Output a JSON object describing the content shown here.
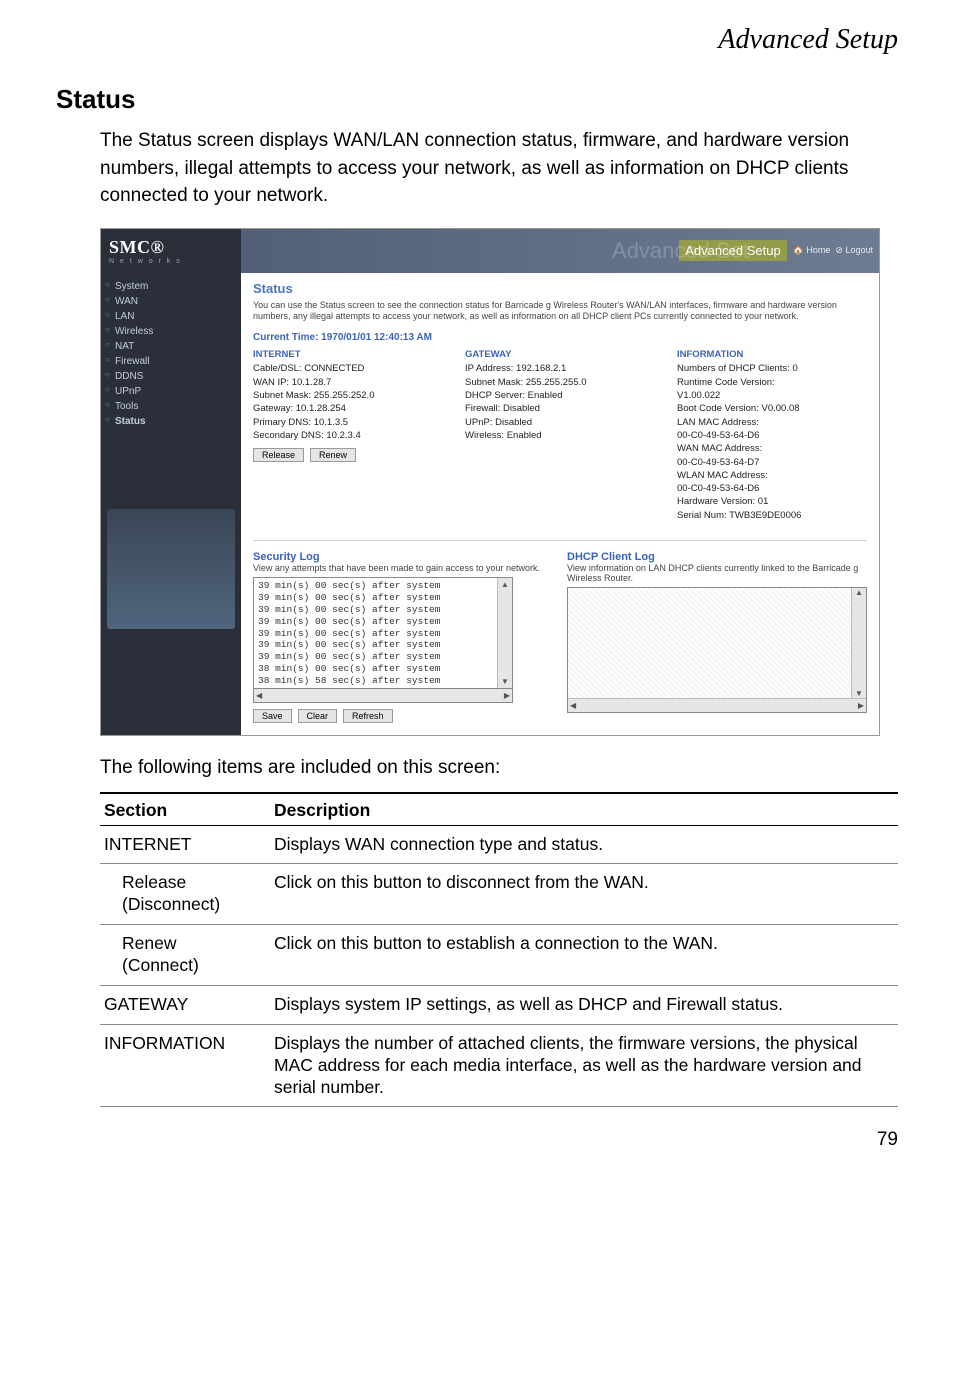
{
  "page": {
    "header": "Advanced Setup",
    "section_title": "Status",
    "intro": "The Status screen displays WAN/LAN connection status, firmware, and hardware version numbers, illegal attempts to access your network, as well as information on DHCP clients connected to your network.",
    "post": "The following items are included on this screen:",
    "pagenum": "79"
  },
  "shot": {
    "logo_main": "SMC®",
    "logo_sub": "N e t w o r k s",
    "banner_ghost": "Advanced Set",
    "banner_tag": "Advanced Setup",
    "banner_home": "Home",
    "banner_logout": "Logout",
    "nav": [
      "System",
      "WAN",
      "LAN",
      "Wireless",
      "NAT",
      "Firewall",
      "DDNS",
      "UPnP",
      "Tools",
      "Status"
    ],
    "status_h": "Status",
    "desc": "You can use the Status screen to see the connection status for Barricade g Wireless Router's WAN/LAN interfaces, firmware and hardware version numbers, any illegal attempts to access your network, as well as information on all DHCP client PCs currently connected to your network.",
    "curtime": "Current Time: 1970/01/01 12:40:13 AM",
    "internet": {
      "h": "INTERNET",
      "lines": [
        "Cable/DSL:  CONNECTED",
        "WAN IP:  10.1.28.7",
        "Subnet Mask:  255.255.252.0",
        "Gateway:  10.1.28.254",
        "Primary DNS:  10.1.3.5",
        "Secondary DNS:  10.2.3.4"
      ],
      "btn_release": "Release",
      "btn_renew": "Renew"
    },
    "gateway": {
      "h": "GATEWAY",
      "lines": [
        "IP Address:  192.168.2.1",
        "Subnet Mask:  255.255.255.0",
        "DHCP Server:  Enabled",
        "Firewall:  Disabled",
        "UPnP:  Disabled",
        "Wireless:  Enabled"
      ]
    },
    "info": {
      "h": "INFORMATION",
      "lines": [
        "Numbers of DHCP Clients:  0",
        "Runtime Code Version:",
        "  V1.00.022",
        "Boot Code Version:  V0.00.08",
        "LAN MAC Address:",
        "  00-C0-49-53-64-D6",
        "WAN MAC Address:",
        "  00-C0-49-53-64-D7",
        "WLAN MAC Address:",
        "  00-C0-49-53-64-D6",
        "Hardware Version:  01",
        "Serial Num:  TWB3E9DE0006"
      ]
    },
    "seclog": {
      "h": "Security Log",
      "d": "View any attempts that have been made to gain access to your network.",
      "lines": "39 min(s) 00 sec(s) after system\n39 min(s) 00 sec(s) after system\n39 min(s) 00 sec(s) after system\n39 min(s) 00 sec(s) after system\n39 min(s) 00 sec(s) after system\n39 min(s) 00 sec(s) after system\n39 min(s) 00 sec(s) after system\n38 min(s) 00 sec(s) after system\n38 min(s) 58 sec(s) after system",
      "btn_save": "Save",
      "btn_clear": "Clear",
      "btn_refresh": "Refresh"
    },
    "dhcp": {
      "h": "DHCP Client Log",
      "d": "View information on LAN DHCP clients currently linked to the Barricade g Wireless Router."
    }
  },
  "table": {
    "th1": "Section",
    "th2": "Description",
    "rows": [
      {
        "s": "INTERNET",
        "d": "Displays WAN connection type and status."
      },
      {
        "s": "Release (Disconnect)",
        "d": "Click on this button to disconnect from the WAN.",
        "indent": true
      },
      {
        "s": "Renew (Connect)",
        "d": "Click on this button to establish a connection to the WAN.",
        "indent": true
      },
      {
        "s": "GATEWAY",
        "d": "Displays system IP settings, as well as DHCP and Firewall status."
      },
      {
        "s": "INFORMATION",
        "d": "Displays the number of attached clients, the firmware versions, the physical MAC address for each media interface, as well as the hardware version and serial number."
      }
    ]
  }
}
